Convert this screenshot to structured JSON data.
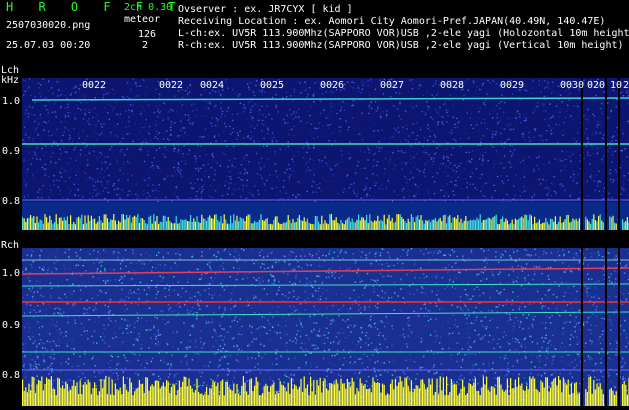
{
  "app": {
    "title": "H R O F F T",
    "version": "2ch 0.30",
    "filename": "2507030020.png",
    "timestamp": "25.07.03 00:20",
    "mode": "meteor",
    "count_lch": "126",
    "count_rch": "2"
  },
  "info": {
    "observer": "Ovserver           : ex. JR7CYX [ kid ]",
    "location": "Receiving Location : ex. Aomori City Aomori-Pref.JAPAN(40.49N, 140.47E)",
    "lch": "L-ch:ex. UV5R 113.900Mhz(SAPPORO VOR)USB ,2-ele yagi (Holozontal 10m height)",
    "rch": "R-ch:ex. UV5R 113.900Mhz(SAPPORO VOR)USB ,2-ele yagi (Vertical 10m height)"
  },
  "lch": {
    "label": "Lch",
    "unit": "kHz",
    "ticks": [
      "1.0",
      "0.9",
      "0.8"
    ]
  },
  "rch": {
    "label": "Rch",
    "ticks": [
      "1.0",
      "0.9",
      "0.8"
    ]
  },
  "time_labels": [
    "0022",
    "0022",
    "0024",
    "0025",
    "0026",
    "0027",
    "0028",
    "0029",
    "0030",
    "020",
    "10",
    "2"
  ],
  "colors": {
    "background": "#000000",
    "header_green": "#20ff20",
    "noise_blue": "#1a2a8c",
    "signal_cyan": "#3fe0e0",
    "meteor_yellow": "#ffff33",
    "carrier_red": "#ff3030"
  }
}
